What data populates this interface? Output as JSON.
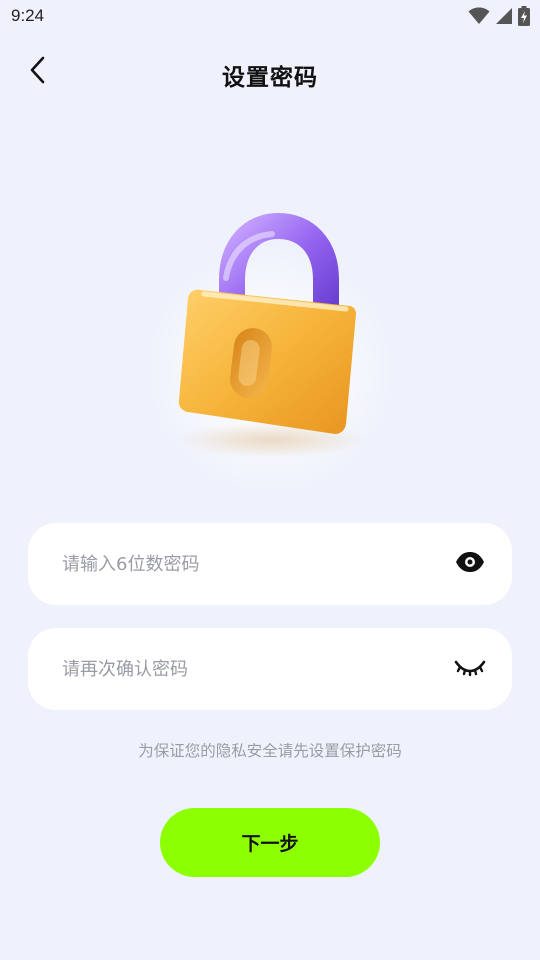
{
  "status_bar": {
    "time": "9:24",
    "icons": [
      "wifi-icon",
      "cellular-signal-icon",
      "battery-charging-icon"
    ]
  },
  "header": {
    "title": "设置密码",
    "back_icon": "chevron-left-icon"
  },
  "hero": {
    "icon": "padlock-illustration"
  },
  "form": {
    "password_placeholder": "请输入6位数密码",
    "password_value": "",
    "password_toggle_icon": "eye-open-icon",
    "confirm_placeholder": "请再次确认密码",
    "confirm_value": "",
    "confirm_toggle_icon": "eye-closed-icon",
    "hint": "为保证您的隐私安全请先设置保护密码"
  },
  "actions": {
    "next_label": "下一步"
  },
  "colors": {
    "background": "#eff2fc",
    "accent_button": "#8cff00",
    "input_background": "#ffffff",
    "placeholder_text": "#9a9ca5",
    "lock_body": "#f6b43a",
    "lock_shackle": "#9b6cf2"
  }
}
